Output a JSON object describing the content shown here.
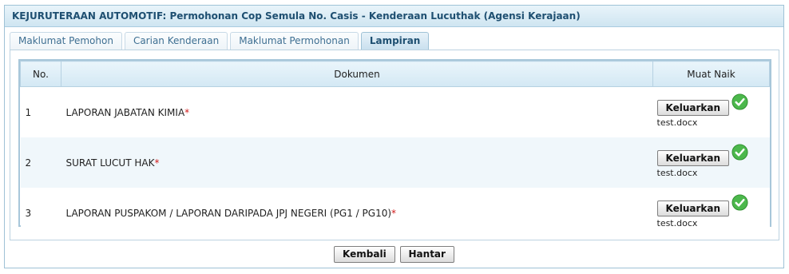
{
  "header": {
    "title": "KEJURUTERAAN AUTOMOTIF: Permohonan Cop Semula No. Casis - Kenderaan Lucuthak (Agensi Kerajaan)"
  },
  "tabs": [
    {
      "label": "Maklumat Pemohon"
    },
    {
      "label": "Carian Kenderaan"
    },
    {
      "label": "Maklumat Permohonan"
    },
    {
      "label": "Lampiran"
    }
  ],
  "active_tab": "Lampiran",
  "table": {
    "headers": {
      "no": "No.",
      "dokumen": "Dokumen",
      "muat_naik": "Muat Naik"
    },
    "required_marker": "*",
    "rows": [
      {
        "no": "1",
        "dokumen": "LAPORAN JABATAN KIMIA",
        "button": "Keluarkan",
        "file": "test.docx"
      },
      {
        "no": "2",
        "dokumen": "SURAT LUCUT HAK",
        "button": "Keluarkan",
        "file": "test.docx"
      },
      {
        "no": "3",
        "dokumen": "LAPORAN PUSPAKOM / LAPORAN DARIPADA JPJ NEGERI (PG1 / PG10)",
        "button": "Keluarkan",
        "file": "test.docx"
      }
    ]
  },
  "footer": {
    "back_label": "Kembali",
    "submit_label": "Hantar"
  },
  "colors": {
    "accent": "#1e4f71",
    "required": "#d11a1a",
    "success": "#4cb84c"
  }
}
